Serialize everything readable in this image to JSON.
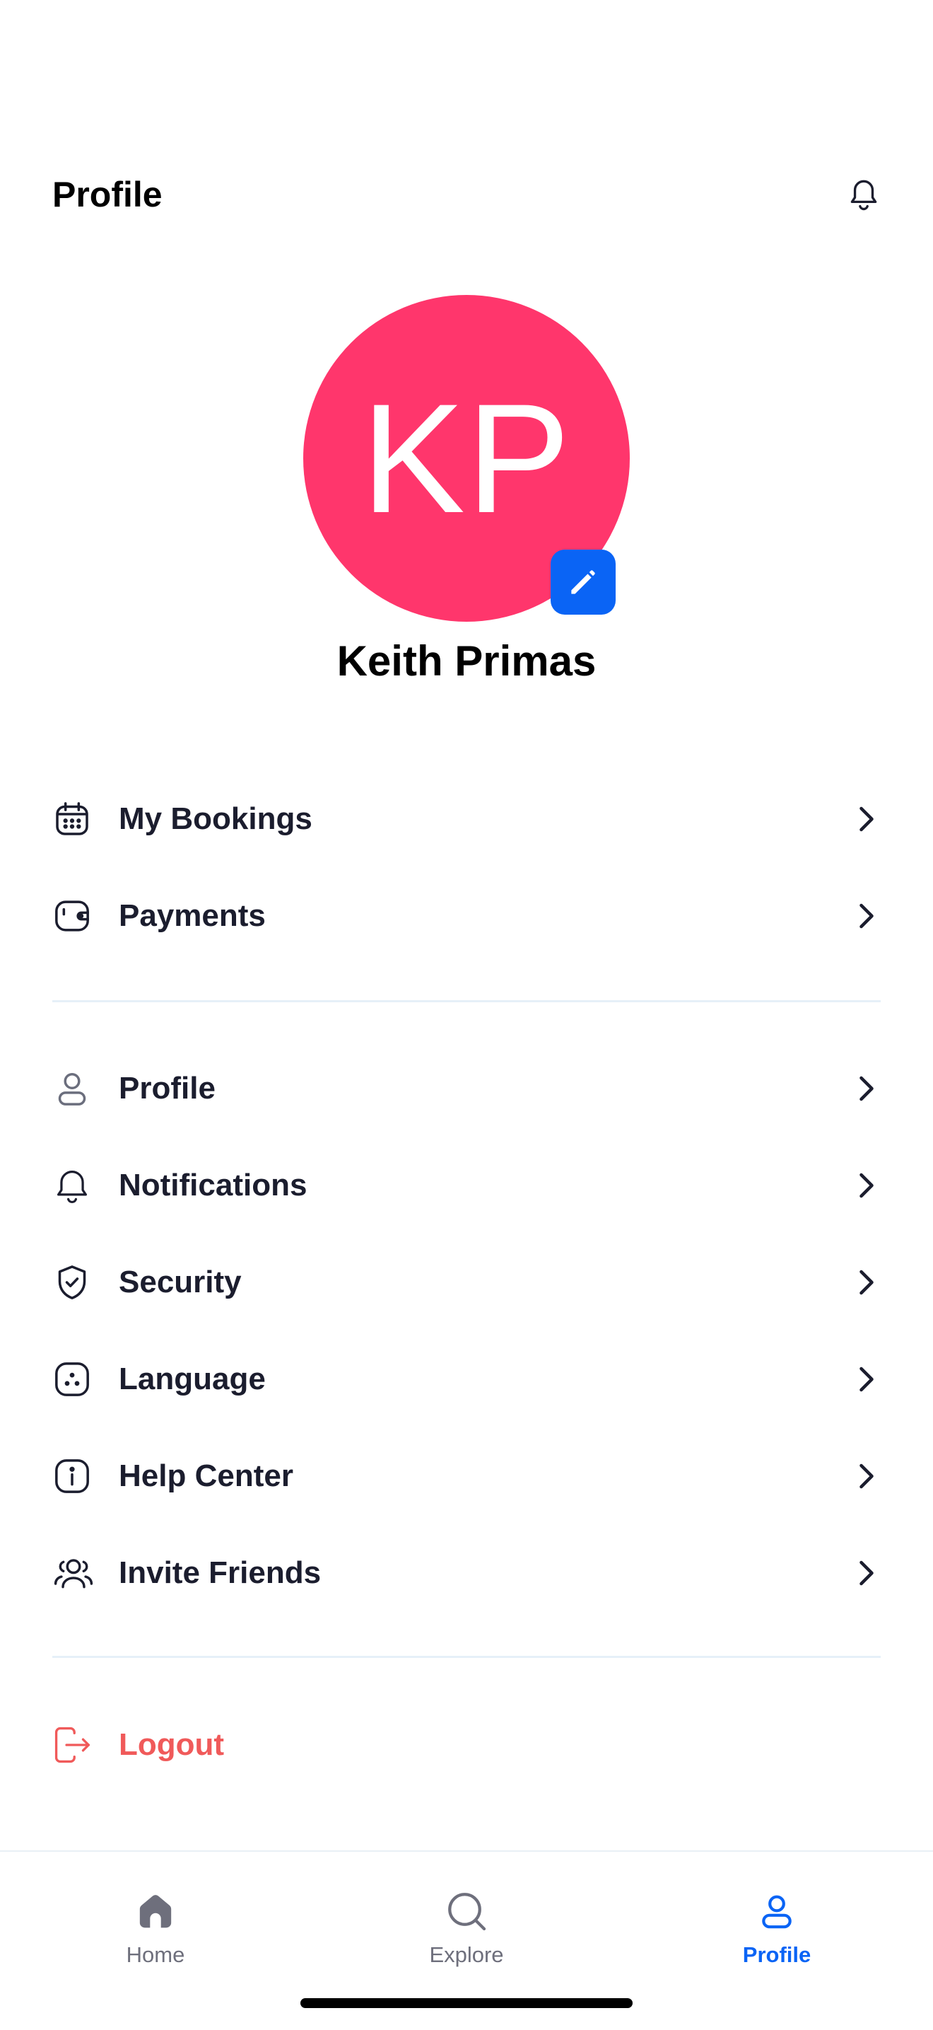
{
  "header": {
    "title": "Profile",
    "notification_icon": "bell-icon"
  },
  "profile": {
    "initials": "KP",
    "name": "Keith Primas",
    "avatar_color": "#ff366c",
    "edit_icon": "pencil-icon"
  },
  "menu_primary": [
    {
      "label": "My Bookings",
      "icon": "calendar-icon"
    },
    {
      "label": "Payments",
      "icon": "wallet-icon"
    }
  ],
  "menu_settings": [
    {
      "label": "Profile",
      "icon": "user-icon"
    },
    {
      "label": "Notifications",
      "icon": "bell-icon"
    },
    {
      "label": "Security",
      "icon": "shield-check-icon"
    },
    {
      "label": "Language",
      "icon": "language-icon"
    },
    {
      "label": "Help Center",
      "icon": "info-icon"
    },
    {
      "label": "Invite Friends",
      "icon": "users-icon"
    }
  ],
  "logout": {
    "label": "Logout",
    "icon": "logout-icon",
    "color": "#f05a5a"
  },
  "tabbar": {
    "tabs": [
      {
        "label": "Home",
        "icon": "home-icon",
        "active": false
      },
      {
        "label": "Explore",
        "icon": "search-icon",
        "active": false
      },
      {
        "label": "Profile",
        "icon": "user-icon",
        "active": true
      }
    ],
    "active_color": "#0a64f5"
  },
  "colors": {
    "accent": "#0a64f5",
    "text": "#1b1d2e",
    "danger": "#f05a5a"
  }
}
